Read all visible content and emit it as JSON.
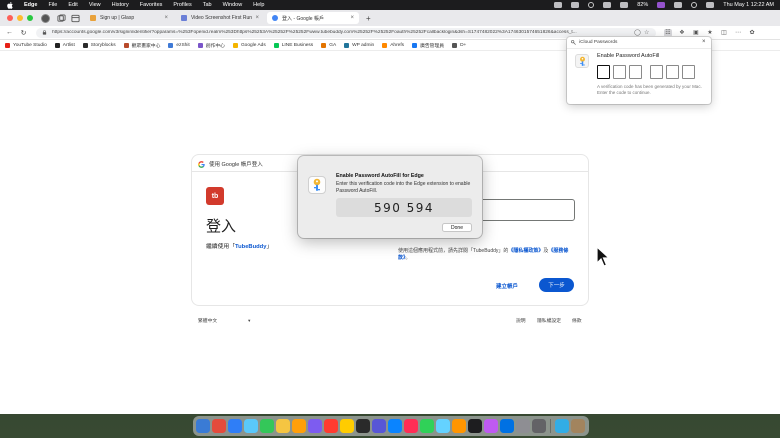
{
  "menubar": {
    "app": "Edge",
    "items": [
      "File",
      "Edit",
      "View",
      "History",
      "Favorites",
      "Profiles",
      "Tab",
      "Window",
      "Help"
    ],
    "battery": "82%",
    "datetime": "Thu May 1 12:22 AM"
  },
  "tabs": [
    {
      "title": "Sign up | Glasp",
      "favicon_color": "#e9a23b"
    },
    {
      "title": "Video Screenshot First Run",
      "favicon_color": "#6b7fd7"
    },
    {
      "title": "登入 - Google 帳戶",
      "favicon_color": "#4285f4"
    }
  ],
  "address": {
    "url": "https://accounts.google.com/v3/signin/identifier?opparams=%253Fopenid.realm%253Dhttps%25253A%25252F%25252Fwww.tubebuddy.com%25252F%25252Foauth%25252Fcallbacklogin&dsh=S1747482022%3A1746301574651826&access_t..."
  },
  "bookmarks": [
    {
      "label": "YouTube Studio",
      "color": "#e62117"
    },
    {
      "label": "Artlist",
      "color": "#222222"
    },
    {
      "label": "Storyblocks",
      "color": "#2b2b2b"
    },
    {
      "label": "觀眾畫家中心",
      "color": "#b84a2b"
    },
    {
      "label": "ezShit",
      "color": "#3f7ad6"
    },
    {
      "label": "創作中心",
      "color": "#7a55c9"
    },
    {
      "label": "Google Ads",
      "color": "#f4b400"
    },
    {
      "label": "LINE Business",
      "color": "#06c755"
    },
    {
      "label": "GA",
      "color": "#e37400"
    },
    {
      "label": "WP admin",
      "color": "#21759b"
    },
    {
      "label": "Ahrefs",
      "color": "#ff8800"
    },
    {
      "label": "廣告管理員",
      "color": "#1877f2"
    },
    {
      "label": "D+",
      "color": "#555555"
    }
  ],
  "card": {
    "header": "使用 Google 帳戶登入",
    "logo": "tb",
    "title": "登入",
    "subtitle_prefix": "繼續使用「",
    "subtitle_link": "TubeBuddy",
    "subtitle_suffix": "」",
    "policy_prefix": "使用這個應用程式前，請先詳閱「TubeBuddy」的",
    "policy_link1": "《隱私權政策》",
    "policy_mid": "及",
    "policy_link2": "《服務條款》",
    "policy_suffix": "。",
    "create_account": "建立帳戶",
    "next": "下一步"
  },
  "footer": {
    "language": "繁體中文",
    "help": "說明",
    "privacy": "隱私權設定",
    "terms": "條款"
  },
  "dialog": {
    "title": "Enable Password AutoFill for Edge",
    "message": "Enter this verification code into the Edge extension to enable Password AutoFill.",
    "code": "590 594",
    "done": "Done"
  },
  "popover": {
    "header": "iCloud Passwords",
    "title": "Enable Password AutoFill",
    "note": "A verification code has been generated by your Mac. Enter the code to continue."
  },
  "dock_colors": [
    "#3a7bd5",
    "#e44b3c",
    "#2f7ef7",
    "#5ac8fa",
    "#34c759",
    "#f5c542",
    "#ff9f0a",
    "#7d5cf0",
    "#ff3b30",
    "#ffcc00",
    "#2a2a2a",
    "#5856d6",
    "#0a84ff",
    "#ff2d55",
    "#30d158",
    "#64d2ff",
    "#ff9500",
    "#1d1d1f",
    "#bf5af2",
    "#0071e3",
    "#8e8e93",
    "#636366",
    "#32ade6",
    "#a2845e"
  ]
}
